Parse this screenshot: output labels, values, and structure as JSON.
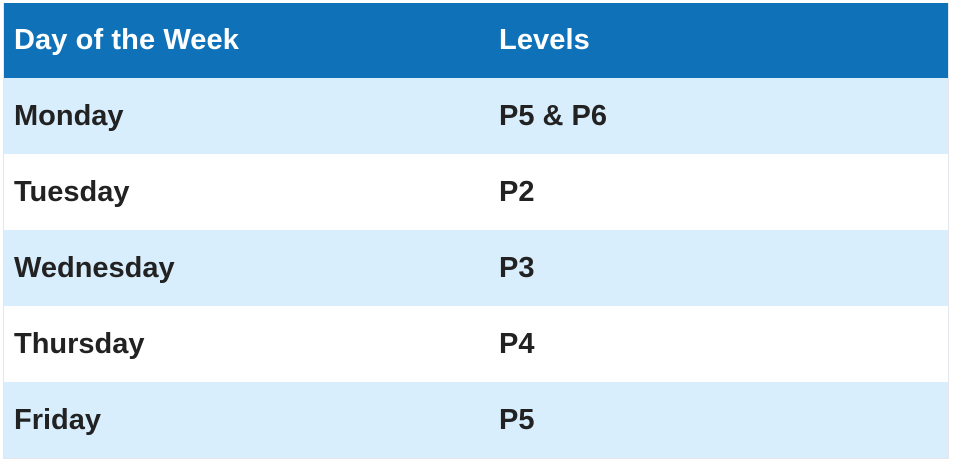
{
  "table": {
    "headers": {
      "day": "Day of the Week",
      "levels": "Levels"
    },
    "rows": [
      {
        "day": "Monday",
        "levels": "P5 & P6"
      },
      {
        "day": "Tuesday",
        "levels": "P2"
      },
      {
        "day": "Wednesday",
        "levels": "P3"
      },
      {
        "day": "Thursday",
        "levels": "P4"
      },
      {
        "day": "Friday",
        "levels": "P5"
      }
    ],
    "colors": {
      "header_bg": "#0f72b9",
      "header_text": "#ffffff",
      "stripe_bg": "#d8eefd",
      "row_bg": "#ffffff",
      "body_text": "#222222"
    }
  }
}
